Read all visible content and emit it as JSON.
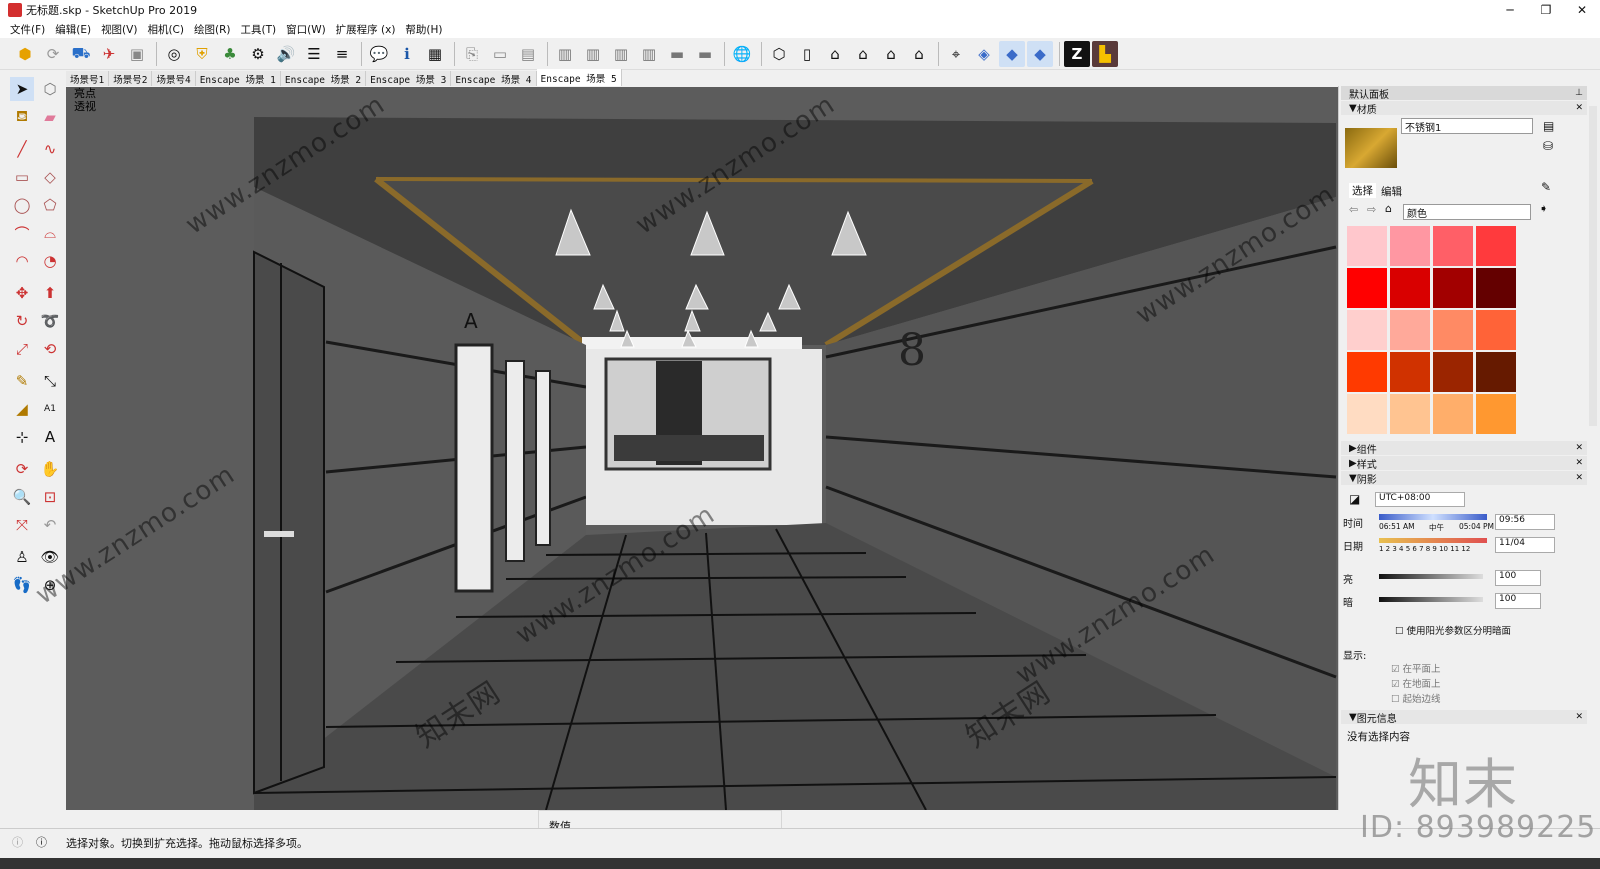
{
  "window": {
    "title": "无标题.skp - SketchUp Pro 2019",
    "min": "─",
    "max": "❐",
    "close": "✕"
  },
  "menu": [
    "文件(F)",
    "编辑(E)",
    "视图(V)",
    "相机(C)",
    "绘图(R)",
    "工具(T)",
    "窗口(W)",
    "扩展程序 (x)",
    "帮助(H)"
  ],
  "scene_tabs": [
    "场景号1",
    "场景号2",
    "场景号4",
    "Enscape 场景 1",
    "Enscape 场景 2",
    "Enscape 场景 3",
    "Enscape 场景 4",
    "Enscape 场景 5"
  ],
  "viewport": {
    "style_label": "亮点",
    "camera_label": "透视",
    "floor_number": "8",
    "elevator_letter": "A"
  },
  "panel": {
    "title": "默认面板",
    "materials": {
      "header": "材质",
      "name": "不锈钢1",
      "tab_select": "选择",
      "tab_edit": "编辑",
      "category": "颜色",
      "colors": [
        "#ffc7cc",
        "#ff97a2",
        "#ff5f67",
        "#ff3a3d",
        "#ff0000",
        "#d90000",
        "#a20000",
        "#640000",
        "#ffcfcd",
        "#ffa99a",
        "#ff8a64",
        "#ff6338",
        "#ff3a00",
        "#d03200",
        "#9b2500",
        "#661a00",
        "#ffdcc2",
        "#ffc491",
        "#ffae6a",
        "#ff9830"
      ]
    },
    "components": "组件",
    "styles": "样式",
    "shadows": {
      "header": "阴影",
      "timezone": "UTC+08:00",
      "time_label": "时间",
      "time_start": "06:51 AM",
      "time_mid": "中午",
      "time_end": "05:04 PM",
      "time_value": "09:56",
      "date_label": "日期",
      "months": "1 2 3 4 5 6 7 8 9 10 11 12",
      "date_value": "11/04",
      "light_label": "亮",
      "light_value": "100",
      "dark_label": "暗",
      "dark_value": "100",
      "sun_checkbox": "使用阳光参数区分明暗面",
      "display_label": "显示:",
      "on_faces": "在平面上",
      "on_ground": "在地面上",
      "from_edges": "起始边线"
    },
    "entity": {
      "header": "图元信息",
      "text": "没有选择内容"
    }
  },
  "status": {
    "message": "选择对象。切换到扩充选择。拖动鼠标选择多项。",
    "measurements_label": "数值"
  },
  "watermark": {
    "url": "www.znzmo.com",
    "cn": "知末网",
    "logo": "知末",
    "id": "ID: 893989225"
  }
}
